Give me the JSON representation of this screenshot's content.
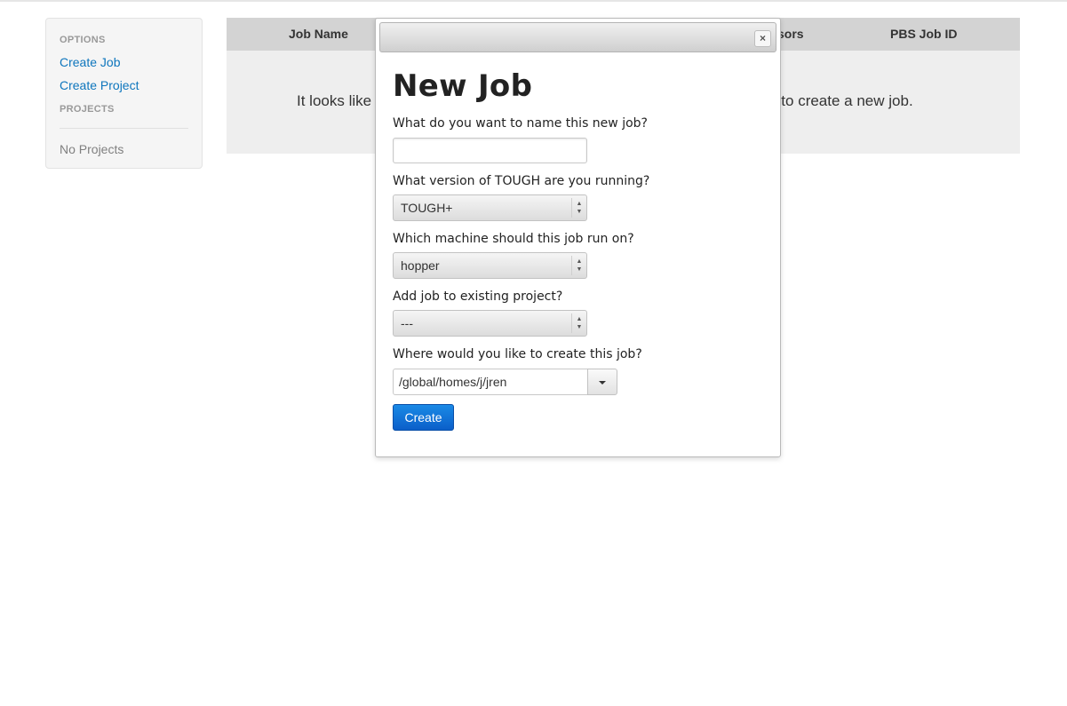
{
  "sidebar": {
    "options_header": "OPTIONS",
    "create_job": "Create Job",
    "create_project": "Create Project",
    "projects_header": "PROJECTS",
    "no_projects": "No Projects"
  },
  "table": {
    "columns": [
      "Job Name",
      "sors",
      "PBS Job ID"
    ],
    "empty_left": "It looks like",
    "empty_right": "bar to create a new job."
  },
  "modal": {
    "close_glyph": "×",
    "title": "New Job",
    "name_question": "What do you want to name this new job?",
    "name_value": "",
    "version_question": "What version of TOUGH are you running?",
    "version_selected": "TOUGH+",
    "machine_question": "Which machine should this job run on?",
    "machine_selected": "hopper",
    "project_question": "Add job to existing project?",
    "project_selected": "---",
    "location_question": "Where would you like to create this job?",
    "location_value": "/global/homes/j/jren",
    "create_label": "Create"
  },
  "colors": {
    "link": "#0e76bd",
    "primary_button": "#0b5fc9",
    "table_header": "#d3d3d3"
  }
}
